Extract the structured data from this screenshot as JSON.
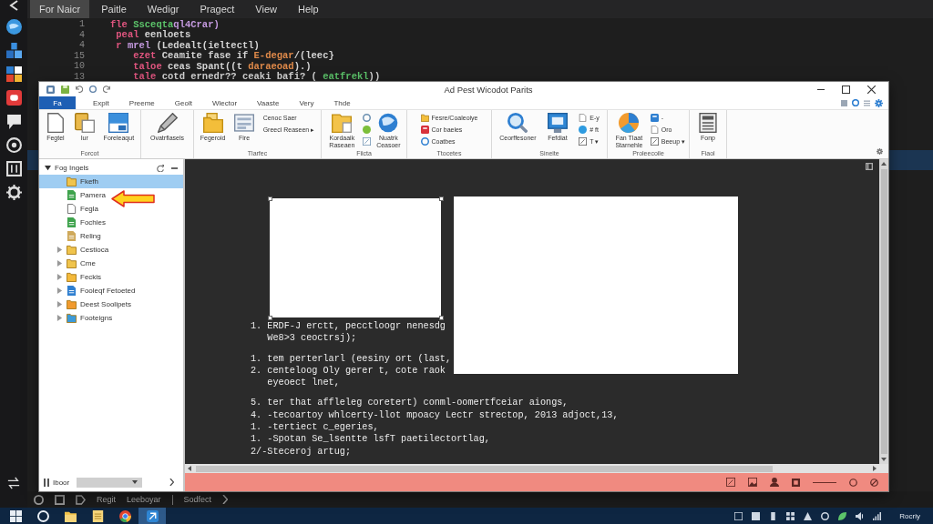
{
  "menu_bar": {
    "items": [
      {
        "label": "For Naicr",
        "selected": true
      },
      {
        "label": "Paitle",
        "selected": false
      },
      {
        "label": "Wedigr",
        "selected": false
      },
      {
        "label": "Pragect",
        "selected": false
      },
      {
        "label": "View",
        "selected": false
      },
      {
        "label": "Help",
        "selected": false
      }
    ]
  },
  "editor": {
    "lines": [
      {
        "number": "1",
        "segments": [
          {
            "text": "fle ",
            "kind": "keyword"
          },
          {
            "text": "Ssceqta",
            "kind": "string"
          },
          {
            "text": "ql4Crar)",
            "kind": "type"
          }
        ]
      },
      {
        "number": "4",
        "segments": [
          {
            "text": " peal",
            "kind": "keyword"
          },
          {
            "text": " eenloets",
            "kind": "plain"
          }
        ]
      },
      {
        "number": "4",
        "segments": [
          {
            "text": " r ",
            "kind": "keyword"
          },
          {
            "text": "mrel",
            "kind": "type"
          },
          {
            "text": " (Ledealt(ieltectl)",
            "kind": "plain"
          }
        ]
      },
      {
        "number": "15",
        "segments": [
          {
            "text": "    ezet",
            "kind": "keyword"
          },
          {
            "text": " Ceamite fase if ",
            "kind": "plain"
          },
          {
            "text": "E-degar",
            "kind": "number"
          },
          {
            "text": "/(leec}",
            "kind": "plain"
          }
        ]
      },
      {
        "number": "10",
        "segments": [
          {
            "text": "    taloe",
            "kind": "keyword"
          },
          {
            "text": " ceas Spant((t ",
            "kind": "plain"
          },
          {
            "text": "daraeoad",
            "kind": "number"
          },
          {
            "text": ").)",
            "kind": "plain"
          }
        ]
      },
      {
        "number": "13",
        "segments": [
          {
            "text": "    tale",
            "kind": "keyword"
          },
          {
            "text": " cotd ernedr?? ceaki bafi? ( ",
            "kind": "plain"
          },
          {
            "text": "eatfrekl",
            "kind": "string"
          },
          {
            "text": "))",
            "kind": "plain"
          }
        ]
      }
    ]
  },
  "paint_window": {
    "title": "Ad Pest Wicodot Parits",
    "tabs": [
      {
        "label": "Fa",
        "selected": true
      },
      {
        "label": "Expit",
        "selected": false
      },
      {
        "label": "Preeme",
        "selected": false
      },
      {
        "label": "Geolt",
        "selected": false
      },
      {
        "label": "Wiector",
        "selected": false
      },
      {
        "label": "Vaaste",
        "selected": false
      },
      {
        "label": "Very",
        "selected": false
      },
      {
        "label": "Thde",
        "selected": false
      }
    ],
    "ribbon": [
      {
        "label": "Forcot",
        "items": [
          {
            "kind": "large",
            "label": "Fegtel"
          },
          {
            "kind": "large",
            "label": "Iur"
          },
          {
            "kind": "large",
            "label": "Foreleaqut"
          }
        ]
      },
      {
        "items": [
          {
            "kind": "large",
            "label": "Ovatrflasels"
          }
        ]
      },
      {
        "label": "Tlarfec",
        "items": [
          {
            "kind": "large",
            "label": "Fegeroid"
          },
          {
            "kind": "large",
            "label": "Fire"
          },
          {
            "kind": "text-stack",
            "labels": [
              "Cenoc Saer",
              "Greecl Reaseen ▸"
            ]
          }
        ]
      },
      {
        "label": "Fiicta",
        "items": [
          {
            "kind": "large",
            "label": "Kordaaik Raseaen"
          },
          {
            "kind": "icon-column"
          },
          {
            "kind": "large",
            "label": "Nuatrk Ceasoer"
          }
        ]
      },
      {
        "label": "Ttocetes",
        "items": [
          {
            "kind": "stack",
            "labels": [
              "Fesre/Coaleoiye",
              "Cor baeles",
              "Coatbes"
            ]
          }
        ]
      },
      {
        "label": "Sineite",
        "items": [
          {
            "kind": "large",
            "label": "Ceorffesoner"
          },
          {
            "kind": "large",
            "label": "Fefdiat"
          },
          {
            "kind": "stack",
            "labels": [
              "E-y",
              "# ft",
              "T ▾"
            ]
          }
        ]
      },
      {
        "label": "Proleecoile",
        "items": [
          {
            "kind": "large",
            "label": "Fan Tlaat Starnehle"
          },
          {
            "kind": "stack",
            "labels": [
              "-",
              "Oro",
              "Beeup ▾"
            ]
          }
        ]
      },
      {
        "label": "Fiaol",
        "items": [
          {
            "kind": "large",
            "label": "Fonp"
          }
        ]
      }
    ],
    "tree": {
      "label": "Fog Ingels",
      "selected": false,
      "expanded": true,
      "children": [
        {
          "label": "Fkefh",
          "selected": true
        },
        {
          "label": "Pamera",
          "selected": false
        },
        {
          "label": "Fegla",
          "selected": false
        },
        {
          "label": "Fochies",
          "selected": false
        },
        {
          "label": "Reling",
          "selected": false
        },
        {
          "label": "Cestioca",
          "selected": false,
          "expanded": false
        },
        {
          "label": "Cme",
          "selected": false,
          "expanded": false
        },
        {
          "label": "Feckis",
          "selected": false,
          "expanded": false
        },
        {
          "label": "Fooleqf Fetoeted",
          "selected": false,
          "expanded": false
        },
        {
          "label": "Deest Soolipets",
          "selected": false,
          "expanded": false
        },
        {
          "label": "Footeigns",
          "selected": false,
          "expanded": false
        }
      ]
    },
    "zoom_box": {
      "label": "Iboor"
    },
    "canvas": {
      "blocks": [
        [
          "1. ERDF-J erctt, pecctloogr nenesdg",
          "   We8>3 ceoctrsj);"
        ],
        [
          "1. tem perterlarl (eesiny ort (last,",
          "2. centeloog Oly gerer t, cote raok",
          "   eyeoect lnet,"
        ],
        [
          "5. ter that affleleg coretert) conml-oomertfceiar aiongs,",
          "4. -tecoartoy whlcerty-llot mpoacy Lectr strectop, 2013 adjoct,13,",
          "1. -tertiect c_egeries,",
          "1. -Spotan Se_lsentte lsfT paetilectortlag,",
          "2/-Steceroj artug;"
        ]
      ]
    }
  },
  "bottom_bar": {
    "items": [
      "Regit",
      "Leeboyar",
      "Sodfect"
    ]
  },
  "taskbar": {
    "buttons": [
      {
        "selected": false
      },
      {
        "selected": false
      },
      {
        "selected": false
      },
      {
        "selected": false
      },
      {
        "selected": false
      },
      {
        "selected": true
      }
    ],
    "clock": "Rocriy"
  }
}
